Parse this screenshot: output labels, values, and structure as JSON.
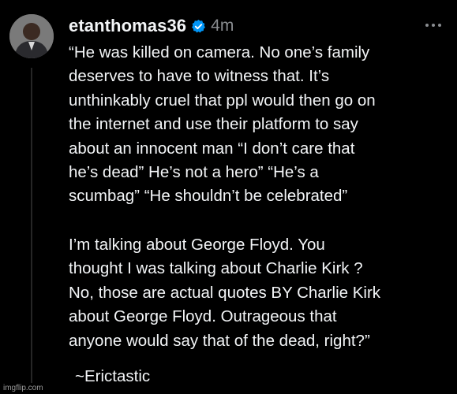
{
  "post": {
    "username": "etanthomas36",
    "timestamp": "4m",
    "paragraph1": [
      "“He was killed on camera. No one’s family",
      "deserves to have to witness that. It’s",
      "unthinkably cruel that ppl would then go on",
      "the internet and use their platform to say",
      "about an innocent man “I don’t care that",
      "he’s dead” He’s not a hero” “He’s a",
      "scumbag” “He shouldn’t be celebrated”"
    ],
    "paragraph2": [
      "I’m talking about George Floyd. You",
      "thought I was talking about Charlie Kirk ?",
      "No, those are actual quotes BY Charlie Kirk",
      "about George Floyd. Outrageous that",
      "anyone would say that of the dead, right?”"
    ],
    "signature": "~Erictastic"
  },
  "icons": {
    "avatar": "avatar-photo",
    "verified": "verified-badge-icon",
    "more": "more-options-icon"
  },
  "colors": {
    "background": "#000000",
    "text": "#f3f5f7",
    "muted": "#8a8d91",
    "verified": "#0095f6"
  },
  "watermark": "imgflip.com"
}
